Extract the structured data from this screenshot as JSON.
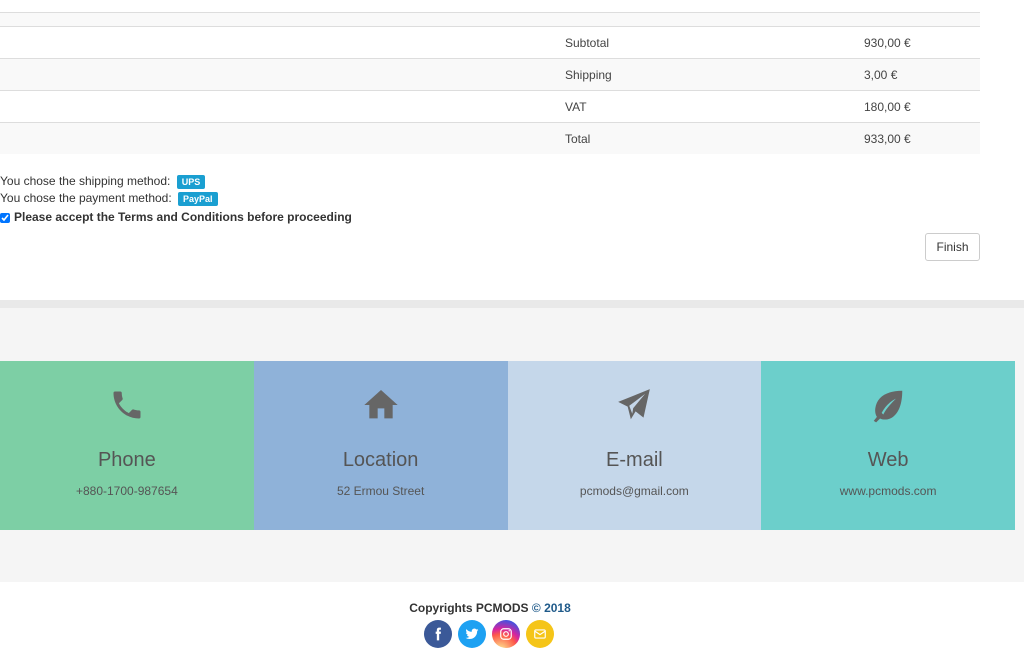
{
  "totals": {
    "rows": [
      {
        "label": "Subtotal",
        "value": "930,00 €"
      },
      {
        "label": "Shipping",
        "value": "3,00 €"
      },
      {
        "label": "VAT",
        "value": "180,00 €"
      },
      {
        "label": "Total",
        "value": "933,00 €"
      }
    ]
  },
  "checkout": {
    "shipping_text": "You chose the shipping method:",
    "shipping_method": "UPS",
    "payment_text": "You chose the payment method:",
    "payment_method": "PayPal",
    "terms_text": "Please accept the Terms and Conditions before proceeding",
    "terms_checked": true,
    "finish_label": "Finish",
    "badge_color": "#1a9fd1"
  },
  "contacts": [
    {
      "title": "Phone",
      "value": "+880-1700-987654",
      "icon": "phone-icon",
      "color": "#7dcfa5"
    },
    {
      "title": "Location",
      "value": "52 Ermou Street",
      "icon": "home-icon",
      "color": "#8fb2d9"
    },
    {
      "title": "E-mail",
      "value": "pcmods@gmail.com",
      "icon": "paper-plane-icon",
      "color": "#c5d7ea"
    },
    {
      "title": "Web",
      "value": "www.pcmods.com",
      "icon": "leaf-icon",
      "color": "#6ccfcb"
    }
  ],
  "footer": {
    "copyright_prefix": "Copyrights PCMODS",
    "copyright_symbol": "©",
    "year": "2018",
    "social": [
      {
        "name": "facebook-icon",
        "color": "#3b5998"
      },
      {
        "name": "twitter-icon",
        "color": "#1da1f2"
      },
      {
        "name": "instagram-icon",
        "color": "#c13584"
      },
      {
        "name": "mail-icon",
        "color": "#f5c518"
      }
    ]
  }
}
